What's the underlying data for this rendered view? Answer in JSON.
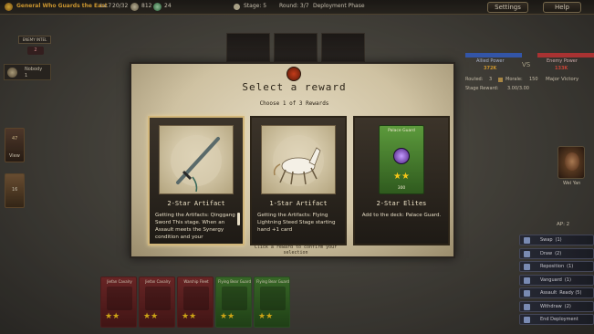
{
  "topbar": {
    "title": "General Who Guards the East",
    "level": "Lv.7",
    "hp": "20/32",
    "gold": "812",
    "gems": "24",
    "stage": "Stage: 5",
    "round": "Round: 3/7",
    "phase": "Deployment Phase",
    "settings_label": "Settings",
    "help_label": "Help"
  },
  "enemy_panel": {
    "title": "ENEMY INTEL",
    "count": "2",
    "unit_name": "Nobody",
    "unit_value": "1"
  },
  "left_panel": {
    "view_count": "47",
    "view_label": "View",
    "deck_count": "16"
  },
  "power_panel": {
    "allied_label": "Allied Power",
    "allied_value": "372K",
    "vs": "VS",
    "enemy_label": "Enemy Power",
    "enemy_value": "133K",
    "routed_label": "Routed:",
    "routed_value": "3",
    "morale_label": "Morale:",
    "morale_value": "150",
    "status": "Major Victory",
    "reward_label": "Stage Reward:",
    "reward_value": "3.00/3.00"
  },
  "general": {
    "name": "Wei Yan"
  },
  "actions": {
    "ap": "AP: 2",
    "buttons": [
      {
        "label": "Swap",
        "count": "(1)"
      },
      {
        "label": "Draw",
        "count": "(2)"
      },
      {
        "label": "Reposition",
        "count": "(1)"
      },
      {
        "label": "Vanguard",
        "count": "(1)"
      },
      {
        "label": "Assault",
        "count": "Ready (5)"
      },
      {
        "label": "Withdraw",
        "count": "(2)"
      },
      {
        "label": "End Deployment",
        "count": ""
      }
    ]
  },
  "hand": [
    {
      "name": "Jiefan Cavalry",
      "stars": "★★",
      "color": "red"
    },
    {
      "name": "Jiefan Cavalry",
      "stars": "★★",
      "color": "red"
    },
    {
      "name": "Warship Fleet",
      "stars": "★★",
      "color": "red"
    },
    {
      "name": "Flying Bear Guard",
      "stars": "★★",
      "color": "green"
    },
    {
      "name": "Flying Bear Guard",
      "stars": "★★",
      "color": "green"
    }
  ],
  "modal": {
    "title": "Select a reward",
    "subtitle": "Choose 1 of 3 Rewards",
    "footer_hint": "Click a reward to confirm your selection",
    "rewards": [
      {
        "title": "2-Star Artifact",
        "description": "Getting the Artifacts: Qinggang Sword This stage. When an Assault meets the Synergy condition and your",
        "art_icon": "sword-icon",
        "selected": true
      },
      {
        "title": "1-Star Artifact",
        "description": "Getting the Artifacts: Flying Lightning Steed Stage starting hand +1 card",
        "art_icon": "horse-icon",
        "selected": false
      },
      {
        "title": "2-Star Elites",
        "description": "Add to the deck: Palace Guard.",
        "card_name": "Palace Guard",
        "card_stars": "★★",
        "card_count": "300",
        "art_icon": "purple-orb-icon",
        "selected": false
      }
    ]
  },
  "colors": {
    "accent_gold": "#f2b236",
    "allied_blue": "#3a64c8",
    "enemy_red": "#c83a3a",
    "star_yellow": "#f5c518"
  }
}
